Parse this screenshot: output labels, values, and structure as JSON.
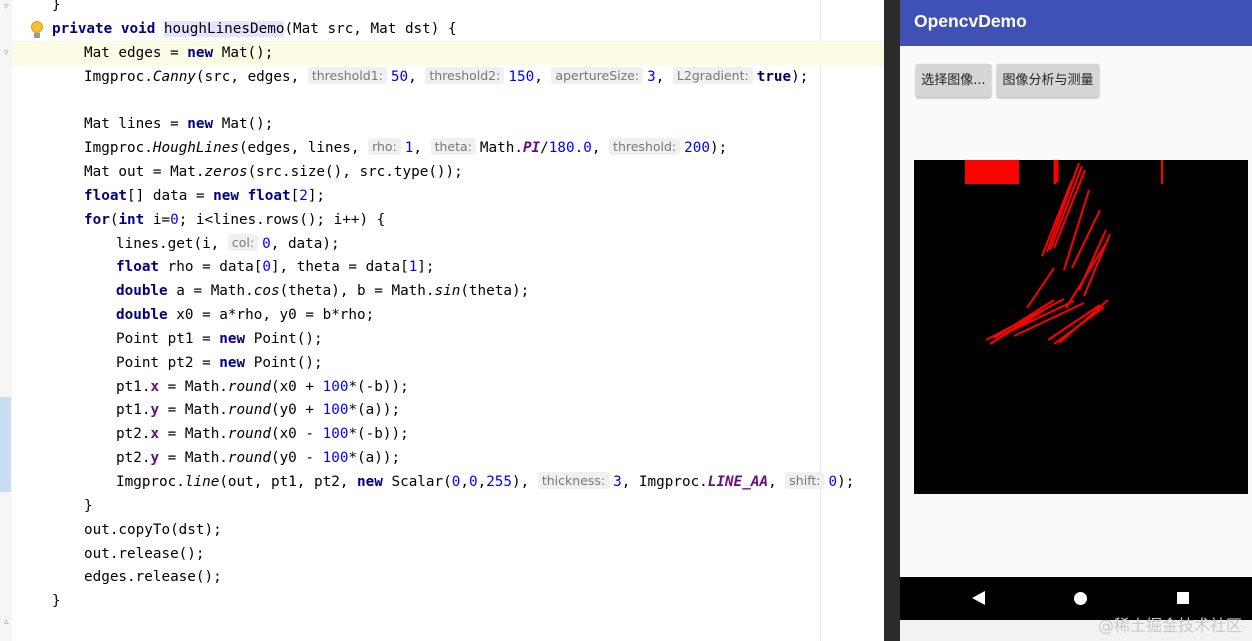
{
  "editor": {
    "lines": [
      {
        "indent": 1,
        "tokens": [
          {
            "t": "}"
          }
        ]
      },
      {
        "indent": 1,
        "tokens": [
          {
            "t": "private",
            "c": "kw"
          },
          {
            "t": " "
          },
          {
            "t": "void",
            "c": "kw"
          },
          {
            "t": " "
          },
          {
            "t": "houghLinesDemo",
            "c": "hl"
          },
          {
            "t": "(Mat src, Mat dst) {"
          }
        ]
      },
      {
        "indent": 2,
        "tokens": [
          {
            "t": "Mat edges = "
          },
          {
            "t": "new",
            "c": "kw"
          },
          {
            "t": " Mat();"
          }
        ]
      },
      {
        "indent": 2,
        "tokens": [
          {
            "t": "Imgproc."
          },
          {
            "t": "Canny",
            "c": "it"
          },
          {
            "t": "(src, edges, "
          },
          {
            "h": "threshold1:"
          },
          {
            "t": "50",
            "c": "num"
          },
          {
            "t": ", "
          },
          {
            "h": "threshold2:"
          },
          {
            "t": "150",
            "c": "num"
          },
          {
            "t": ", "
          },
          {
            "h": "apertureSize:"
          },
          {
            "t": "3",
            "c": "num"
          },
          {
            "t": ", "
          },
          {
            "h": "L2gradient:"
          },
          {
            "t": "true",
            "c": "kw"
          },
          {
            "t": ");"
          }
        ]
      },
      {
        "indent": 2,
        "tokens": []
      },
      {
        "indent": 2,
        "tokens": [
          {
            "t": "Mat lines = "
          },
          {
            "t": "new",
            "c": "kw"
          },
          {
            "t": " Mat();"
          }
        ]
      },
      {
        "indent": 2,
        "tokens": [
          {
            "t": "Imgproc."
          },
          {
            "t": "HoughLines",
            "c": "it"
          },
          {
            "t": "(edges, lines, "
          },
          {
            "h": "rho:"
          },
          {
            "t": "1",
            "c": "num"
          },
          {
            "t": ", "
          },
          {
            "h": "theta:"
          },
          {
            "t": "Math."
          },
          {
            "t": "PI",
            "c": "const"
          },
          {
            "t": "/"
          },
          {
            "t": "180.0",
            "c": "num"
          },
          {
            "t": ", "
          },
          {
            "h": "threshold:"
          },
          {
            "t": "200",
            "c": "num"
          },
          {
            "t": ");"
          }
        ]
      },
      {
        "indent": 2,
        "tokens": [
          {
            "t": "Mat out = Mat."
          },
          {
            "t": "zeros",
            "c": "it"
          },
          {
            "t": "(src.size(), src.type());"
          }
        ]
      },
      {
        "indent": 2,
        "tokens": [
          {
            "t": "float",
            "c": "kw"
          },
          {
            "t": "[] data = "
          },
          {
            "t": "new",
            "c": "kw"
          },
          {
            "t": " "
          },
          {
            "t": "float",
            "c": "kw"
          },
          {
            "t": "["
          },
          {
            "t": "2",
            "c": "num"
          },
          {
            "t": "];"
          }
        ]
      },
      {
        "indent": 2,
        "tokens": [
          {
            "t": "for",
            "c": "kw"
          },
          {
            "t": "("
          },
          {
            "t": "int",
            "c": "kw"
          },
          {
            "t": " i="
          },
          {
            "t": "0",
            "c": "num"
          },
          {
            "t": "; i<lines.rows(); i++) {"
          }
        ]
      },
      {
        "indent": 3,
        "tokens": [
          {
            "t": "lines.get(i, "
          },
          {
            "h": "col:"
          },
          {
            "t": "0",
            "c": "num"
          },
          {
            "t": ", data);"
          }
        ]
      },
      {
        "indent": 3,
        "tokens": [
          {
            "t": "float",
            "c": "kw"
          },
          {
            "t": " rho = data["
          },
          {
            "t": "0",
            "c": "num"
          },
          {
            "t": "], theta = data["
          },
          {
            "t": "1",
            "c": "num"
          },
          {
            "t": "];"
          }
        ]
      },
      {
        "indent": 3,
        "tokens": [
          {
            "t": "double",
            "c": "kw"
          },
          {
            "t": " a = Math."
          },
          {
            "t": "cos",
            "c": "it"
          },
          {
            "t": "(theta), b = Math."
          },
          {
            "t": "sin",
            "c": "it"
          },
          {
            "t": "(theta);"
          }
        ]
      },
      {
        "indent": 3,
        "tokens": [
          {
            "t": "double",
            "c": "kw"
          },
          {
            "t": " x0 = a*rho, y0 = b*rho;"
          }
        ]
      },
      {
        "indent": 3,
        "tokens": [
          {
            "t": "Point pt1 = "
          },
          {
            "t": "new",
            "c": "kw"
          },
          {
            "t": " Point();"
          }
        ]
      },
      {
        "indent": 3,
        "tokens": [
          {
            "t": "Point pt2 = "
          },
          {
            "t": "new",
            "c": "kw"
          },
          {
            "t": " Point();"
          }
        ]
      },
      {
        "indent": 3,
        "tokens": [
          {
            "t": "pt1."
          },
          {
            "t": "x",
            "c": "field"
          },
          {
            "t": " = Math."
          },
          {
            "t": "round",
            "c": "it"
          },
          {
            "t": "(x0 + "
          },
          {
            "t": "100",
            "c": "num"
          },
          {
            "t": "*(-b));"
          }
        ]
      },
      {
        "indent": 3,
        "tokens": [
          {
            "t": "pt1."
          },
          {
            "t": "y",
            "c": "field"
          },
          {
            "t": " = Math."
          },
          {
            "t": "round",
            "c": "it"
          },
          {
            "t": "(y0 + "
          },
          {
            "t": "100",
            "c": "num"
          },
          {
            "t": "*(a));"
          }
        ]
      },
      {
        "indent": 3,
        "tokens": [
          {
            "t": "pt2."
          },
          {
            "t": "x",
            "c": "field"
          },
          {
            "t": " = Math."
          },
          {
            "t": "round",
            "c": "it"
          },
          {
            "t": "(x0 - "
          },
          {
            "t": "100",
            "c": "num"
          },
          {
            "t": "*(-b));"
          }
        ]
      },
      {
        "indent": 3,
        "tokens": [
          {
            "t": "pt2."
          },
          {
            "t": "y",
            "c": "field"
          },
          {
            "t": " = Math."
          },
          {
            "t": "round",
            "c": "it"
          },
          {
            "t": "(y0 - "
          },
          {
            "t": "100",
            "c": "num"
          },
          {
            "t": "*(a));"
          }
        ]
      },
      {
        "indent": 3,
        "tokens": [
          {
            "t": "Imgproc."
          },
          {
            "t": "line",
            "c": "it"
          },
          {
            "t": "(out, pt1, pt2, "
          },
          {
            "t": "new",
            "c": "kw"
          },
          {
            "t": " Scalar("
          },
          {
            "t": "0",
            "c": "num"
          },
          {
            "t": ","
          },
          {
            "t": "0",
            "c": "num"
          },
          {
            "t": ","
          },
          {
            "t": "255",
            "c": "num"
          },
          {
            "t": "), "
          },
          {
            "h": "thickness:"
          },
          {
            "t": "3",
            "c": "num"
          },
          {
            "t": ", Imgproc."
          },
          {
            "t": "LINE_AA",
            "c": "const"
          },
          {
            "t": ", "
          },
          {
            "h": "shift:"
          },
          {
            "t": "0",
            "c": "num"
          },
          {
            "t": ");"
          }
        ]
      },
      {
        "indent": 2,
        "tokens": [
          {
            "t": "}"
          }
        ]
      },
      {
        "indent": 2,
        "tokens": [
          {
            "t": "out.copyTo(dst);"
          }
        ]
      },
      {
        "indent": 2,
        "tokens": [
          {
            "t": "out.release();"
          }
        ]
      },
      {
        "indent": 2,
        "tokens": [
          {
            "t": "edges.release();"
          }
        ]
      },
      {
        "indent": 1,
        "tokens": [
          {
            "t": "}"
          }
        ]
      }
    ]
  },
  "phone": {
    "app_title": "OpencvDemo",
    "buttons": {
      "select_image": "选择图像...",
      "analyze": "图像分析与测量"
    },
    "image_alt": "Hough lines result",
    "line_color": "#ff0000",
    "nav": {
      "back_icon": "back-triangle-icon",
      "home_icon": "home-circle-icon",
      "recent_icon": "recent-square-icon"
    }
  },
  "watermark": "@稀土掘金技术社区",
  "colors": {
    "appbar": "#3f51b5",
    "keyword": "#000080",
    "number": "#0000ff",
    "constant": "#660e7a"
  }
}
